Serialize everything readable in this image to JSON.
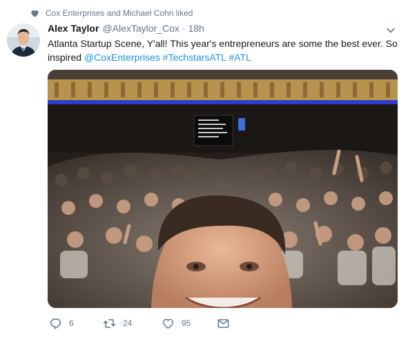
{
  "social_context": {
    "text": "Cox Enterprises and Michael Cohn liked",
    "icon": "heart-icon"
  },
  "tweet": {
    "fullname": "Alex Taylor",
    "username": "@AlexTaylor_Cox",
    "separator": "·",
    "timestamp": "18h",
    "text_plain": "Atlanta Startup Scene, Y'all! This year's entrepreneurs are some the best ever. So inspired ",
    "mentions": [
      "@CoxEnterprises",
      "#TechstarsATL",
      "#ATL"
    ],
    "link_color": "#1b95e0",
    "media": {
      "description_icon": "photo"
    }
  },
  "actions": {
    "reply": {
      "count": "6",
      "icon": "reply-icon"
    },
    "retweet": {
      "count": "24",
      "icon": "retweet-icon"
    },
    "like": {
      "count": "95",
      "icon": "heart-icon"
    },
    "message": {
      "icon": "envelope-icon"
    }
  },
  "colors": {
    "secondary_text": "#657786",
    "icon_gray": "#657786",
    "primary_text": "#14171a"
  }
}
